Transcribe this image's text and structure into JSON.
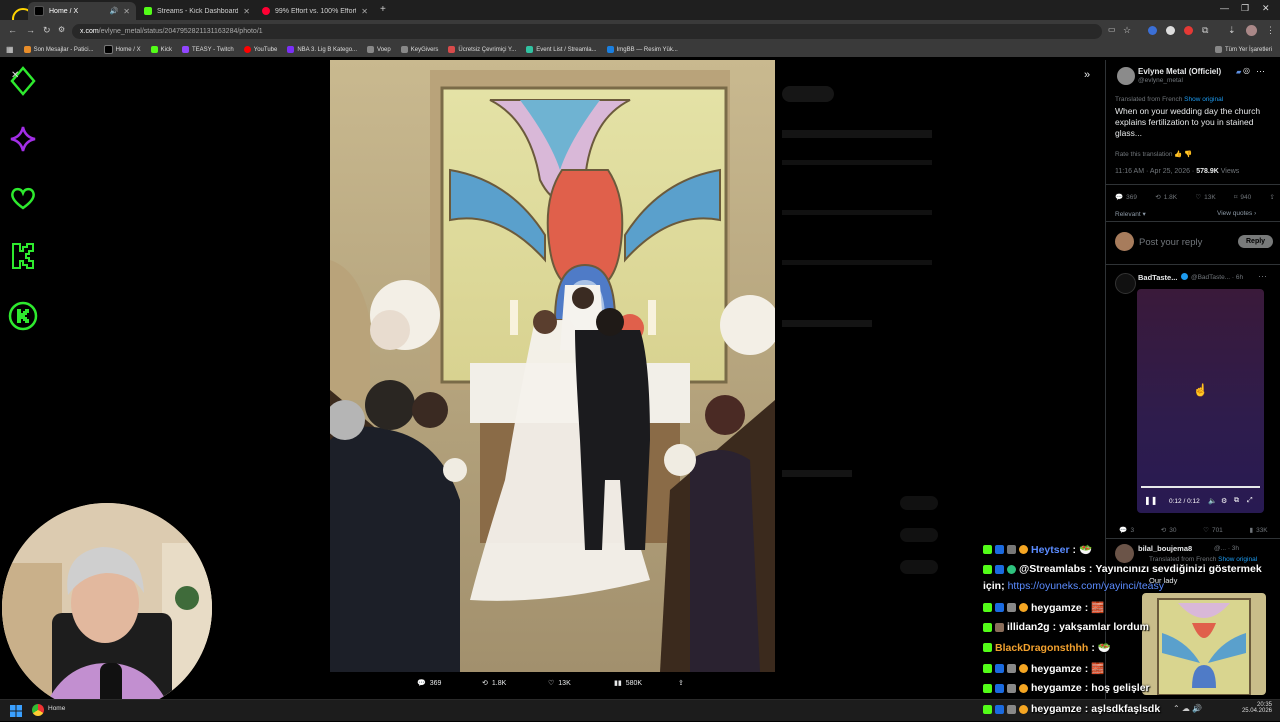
{
  "browser": {
    "tabs": [
      {
        "title": "Home / X",
        "color": "#000000"
      },
      {
        "title": "Streams - Kick Dashboard",
        "color": "#53fc18"
      },
      {
        "title": "99% Effort vs. 100% Effort - Yo",
        "color": "#ff0033"
      }
    ],
    "url_host": "x.com",
    "url_path": "/evlyne_metal/status/2047952821131163284/photo/1",
    "bookmarks": [
      {
        "label": "Son Mesajlar - Patici...",
        "color": "#e88d2a"
      },
      {
        "label": "Home / X",
        "color": "#000000"
      },
      {
        "label": "Kick",
        "color": "#53fc18"
      },
      {
        "label": "TEASY - Twitch",
        "color": "#9146ff"
      },
      {
        "label": "YouTube",
        "color": "#ff0000"
      },
      {
        "label": "NBA 3. Lig B Katego...",
        "color": "#7b2ff7"
      },
      {
        "label": "Voep",
        "color": "#888888"
      },
      {
        "label": "KeyGivers",
        "color": "#888888"
      },
      {
        "label": "Ücretsiz Çevrimiçi Y...",
        "color": "#d84b4b"
      },
      {
        "label": "Event List / Streamla...",
        "color": "#31c3a2"
      },
      {
        "label": "ImgBB — Resim Yük...",
        "color": "#1a7fe0"
      }
    ],
    "all_bookmarks": "Tüm Yer İşaretleri"
  },
  "photo_stats": {
    "replies": "369",
    "reposts": "1.8K",
    "likes": "13K",
    "views": "580K"
  },
  "sidebar": {
    "author_name": "Evlyne Metal (Officiel)",
    "author_handle": "@evlyne_metal",
    "translated_from": "Translated from French",
    "show_original": "Show original",
    "tweet_text": "When on your wedding day the church explains fertilization to you in stained glass...",
    "rate_translation": "Rate this translation",
    "timestamp": "11:16 AM · Apr 25, 2026 ·",
    "views_count": "578.9K",
    "views_label": "Views",
    "stats": {
      "replies": "369",
      "reposts": "1.8K",
      "likes": "13K",
      "bookmarks": "940"
    },
    "relevant": "Relevant",
    "view_quotes": "View quotes",
    "reply_placeholder": "Post your reply",
    "reply_button": "Reply",
    "reply1_name": "BadTaste...",
    "reply1_handle": "@BadTaste... · 6h",
    "video_time": "0:12 / 0:12",
    "reply1_stats": {
      "replies": "3",
      "reposts": "30",
      "likes": "701",
      "views": "33K"
    },
    "reply2_name": "bilal_boujema8",
    "reply2_handle": "@... · 3h",
    "reply2_translated": "Translated from French",
    "reply2_show_original": "Show original",
    "reply2_text": "Our lady"
  },
  "chat": [
    {
      "user": "Heytser",
      "user_color": "#5b8cff",
      "text": ""
    },
    {
      "user": "@Streamlabs",
      "user_color": "#ffffff",
      "text": "Yayıncınızı sevdiğinizi göstermek"
    },
    {
      "user": "",
      "user_color": "#ffffff",
      "text": "için;",
      "link": "https://oyuneks.com/yayinci/teasy"
    },
    {
      "user": "heygamze",
      "user_color": "#ffffff",
      "text": ""
    },
    {
      "user": "illidan2g",
      "user_color": "#ffffff",
      "text": "yakşamlar lordum"
    },
    {
      "user": "BlackDragonsthhh",
      "user_color": "#f2a12e",
      "text": ""
    },
    {
      "user": "heygamze",
      "user_color": "#ffffff",
      "text": ""
    },
    {
      "user": "heygamze",
      "user_color": "#ffffff",
      "text": "hoş gelişler"
    },
    {
      "user": "heygamze",
      "user_color": "#ffffff",
      "text": "aşlsdkfaşlsdk"
    }
  ],
  "taskbar": {
    "app_label": "Home",
    "time": "20:35",
    "date": "25.04.2026"
  }
}
